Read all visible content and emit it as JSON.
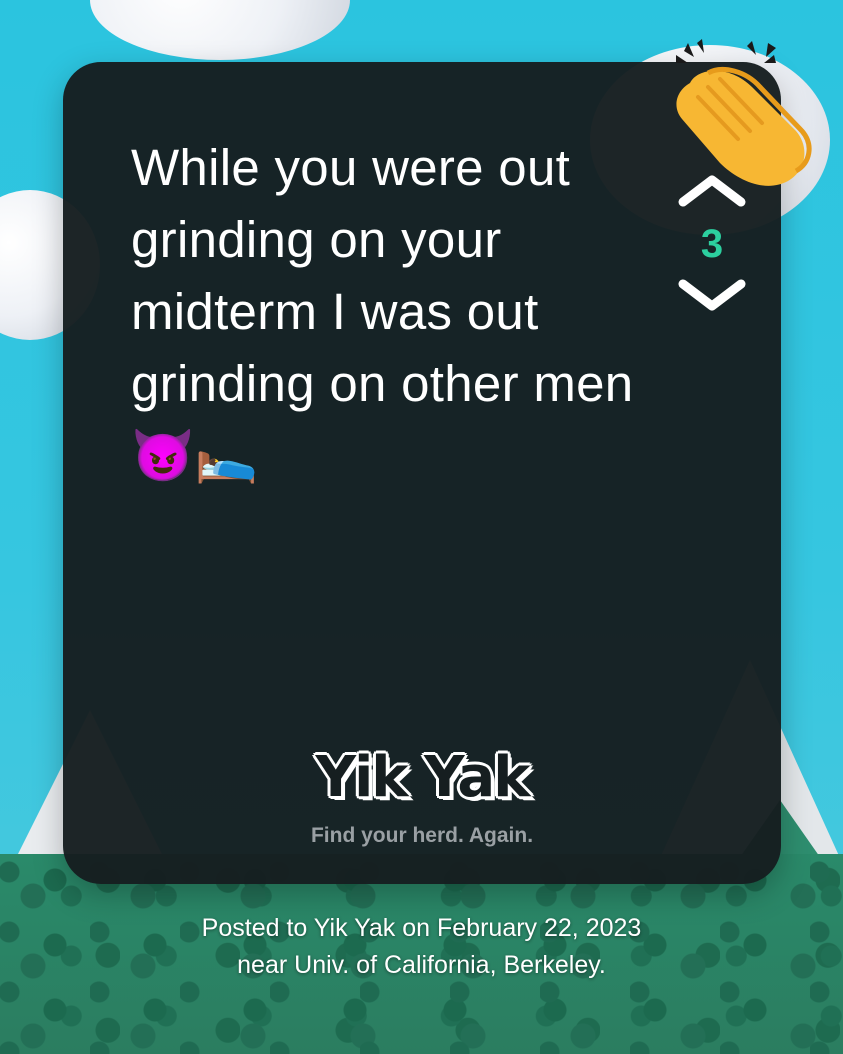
{
  "post": {
    "text": "While you were out grinding on your midterm I was out grinding on other men 😈🛌"
  },
  "votes": {
    "count": "3",
    "upvote_icon": "chevron-up-icon",
    "downvote_icon": "chevron-down-icon",
    "reaction_icon": "clapping-hands-icon"
  },
  "brand": {
    "logo": "Yik Yak",
    "tagline": "Find your herd. Again."
  },
  "footer": {
    "caption": "Posted to Yik Yak on February 22, 2023 near Univ. of California, Berkeley."
  },
  "colors": {
    "card_background": "#161e20",
    "vote_count": "#2ccf9f",
    "sky": "#2bc4df"
  }
}
